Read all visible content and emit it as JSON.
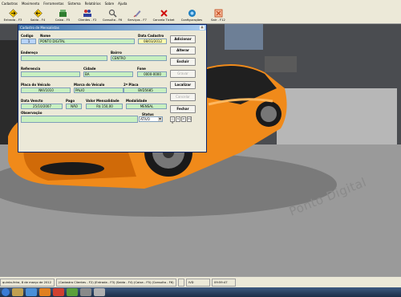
{
  "menu": [
    "Cadastros",
    "Movimento",
    "Ferramentas",
    "Sistema",
    "Relatórios",
    "Sobre",
    "Ajuda"
  ],
  "toolbar": [
    {
      "label": "Entrada - F3",
      "icon": "arrow-right-icon",
      "color": "#f2c200"
    },
    {
      "label": "Saída - F4",
      "icon": "arrow-left-icon",
      "color": "#f2c200"
    },
    {
      "label": "Caixa - F5",
      "icon": "cash-register-icon",
      "color": "#2f7d2f"
    },
    {
      "label": "Clientes - F2",
      "icon": "clients-icon",
      "color": "#2d3f9e"
    },
    {
      "label": "Consulta - F6",
      "icon": "search-icon",
      "color": "#888888"
    },
    {
      "label": "Serviços - F7",
      "icon": "services-icon",
      "color": "#6060a0"
    },
    {
      "label": "Cancela Ticket",
      "icon": "close-icon",
      "color": "#d01010"
    },
    {
      "label": "Configurações",
      "icon": "settings-icon",
      "color": "#1e7fc0"
    },
    {
      "label": "Sair - F12",
      "icon": "exit-icon",
      "color": "#c04010"
    }
  ],
  "window": {
    "title": "Cadastro de Mensalistas",
    "close": "X"
  },
  "form": {
    "codigo_label": "Codigo",
    "codigo": "1",
    "nome_label": "Nome",
    "nome": "PONTO DIGITAL",
    "data_cadastro_label": "Data Cadastro",
    "data_cadastro": "08/03/2012",
    "endereco_label": "Endereço",
    "endereco": "",
    "bairro_label": "Bairro",
    "bairro": "CENTRO",
    "referencia_label": "Referencia",
    "referencia": "",
    "cidade_label": "Cidade",
    "cidade": "BA",
    "fone_label": "Fone",
    "fone": "0000-0000",
    "placa_label": "Placa do Veiculo",
    "placa": "NKV1010",
    "marca_label": "Marca do Veiculo",
    "marca": "PALIO",
    "placa2_label": "2ª Placa",
    "placa2": "BVD5685",
    "data_vencto_label": "Data Vencto",
    "data_vencto": "25/10/2007",
    "pago_label": "Pago",
    "pago": "NÃO",
    "valor_label": "Valor Mensalidade",
    "valor": "R$ 150,00",
    "modalidade_label": "Modalidade",
    "modalidade": "MENSAL",
    "observacao_label": "Observação",
    "observacao": "",
    "status_label": "Status",
    "status": "ATIVO"
  },
  "buttons": {
    "adicionar": "Adicionar",
    "alterar": "Alterar",
    "excluir": "Excluir",
    "gravar": "Gravar",
    "localizar": "Localizar",
    "cancelar": "Cancelar",
    "fechar": "Fechar"
  },
  "nav": [
    "|<",
    "<",
    ">",
    ">|"
  ],
  "watermark": "Ponto Digital",
  "statusbar": {
    "date": "quinta-feira, 8 de março de 2012",
    "shortcuts": "(Cadastra Clientes - F2) (Entrada - F3) (Saida - F4) (Caixa - F5) (Consulta - F6)",
    "ind": "IVD",
    "time": "09:59:47"
  }
}
